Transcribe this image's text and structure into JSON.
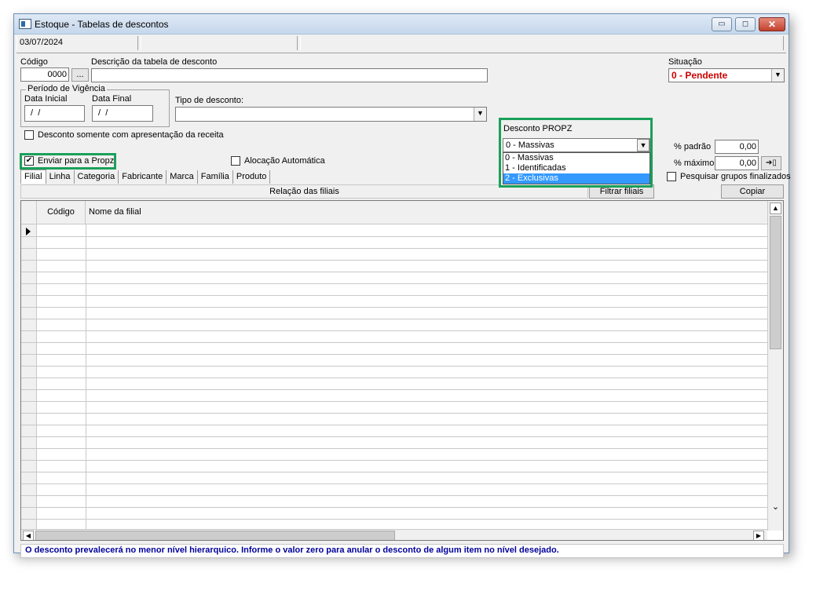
{
  "window": {
    "title": "Estoque - Tabelas de descontos",
    "minimize_label": "▭",
    "maximize_label": "◻",
    "close_label": "✕"
  },
  "status": {
    "date": "03/07/2024"
  },
  "form": {
    "codigo_label": "Código",
    "codigo_value": "0000",
    "lookup_label": "...",
    "descricao_label": "Descrição da tabela de desconto",
    "descricao_value": "",
    "situacao_label": "Situação",
    "situacao_value": "0 - Pendente",
    "periodo_label": "Período de Vigência",
    "data_inicial_label": "Data Inicial",
    "data_inicial_value": " /  /",
    "data_final_label": "Data Final",
    "data_final_value": " /  /",
    "tipo_desconto_label": "Tipo de desconto:",
    "tipo_desconto_value": "",
    "desconto_receita_label": "Desconto somente com apresentação da receita",
    "enviar_propz_label": "Enviar para a Propz",
    "enviar_propz_checked": true,
    "alocacao_label": "Alocação Automática",
    "desconto_propz_label": "Desconto PROPZ",
    "desconto_propz_value": "0 - Massivas",
    "desconto_propz_options": [
      "0 - Massivas",
      "1 - Identificadas",
      "2 - Exclusivas"
    ],
    "pct_padrao_label": "% padrão",
    "pct_padrao_value": "0,00",
    "pct_maximo_label": "% máximo",
    "pct_maximo_value": "0,00",
    "pesquisar_label": "Pesquisar grupos finalizados"
  },
  "tabs": [
    "Filial",
    "Linha",
    "Categoria",
    "Fabricante",
    "Marca",
    "Família",
    "Produto"
  ],
  "grid": {
    "section_title": "Relação das filiais",
    "filtrar_label": "Filtrar filiais",
    "copiar_label": "Copiar",
    "columns": [
      "Código",
      "Nome da filial"
    ]
  },
  "footer": {
    "message": "O desconto prevalecerá no menor nível hierarquico. Informe o valor zero para anular o desconto de algum item no nível desejado."
  },
  "colors": {
    "accent_red": "#cc0000",
    "highlight_green": "#1aa05a",
    "footer_blue": "#00009c",
    "selection_blue": "#3399ff"
  }
}
